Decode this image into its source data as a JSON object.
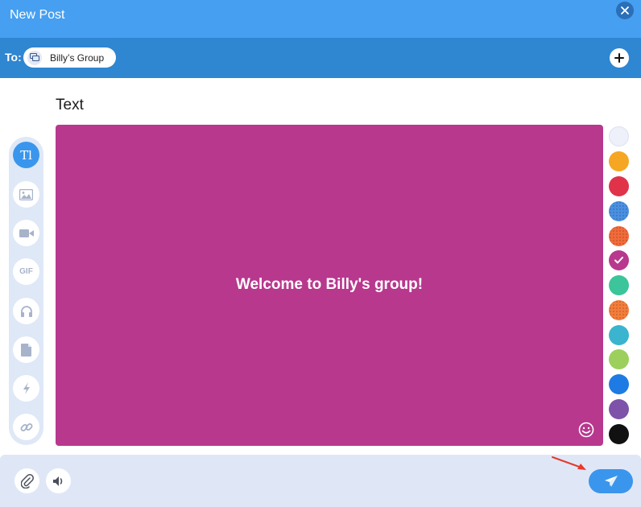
{
  "header": {
    "title": "New Post"
  },
  "to_bar": {
    "label": "To:",
    "recipient": "Billy’s Group"
  },
  "section": {
    "title": "Text"
  },
  "tools": [
    {
      "name": "text",
      "icon": "text-icon",
      "active": true
    },
    {
      "name": "image",
      "icon": "image-icon",
      "active": false
    },
    {
      "name": "video",
      "icon": "video-icon",
      "active": false
    },
    {
      "name": "gif",
      "icon": "gif-icon",
      "active": false,
      "label": "GIF"
    },
    {
      "name": "audio",
      "icon": "headphones-icon",
      "active": false
    },
    {
      "name": "document",
      "icon": "document-icon",
      "active": false
    },
    {
      "name": "flash",
      "icon": "lightning-icon",
      "active": false
    },
    {
      "name": "link",
      "icon": "link-icon",
      "active": false
    }
  ],
  "text_icon_label": "Tl",
  "canvas": {
    "text": "Welcome to Billy's group!",
    "background": "#b8388e"
  },
  "colors": [
    {
      "hex": "#eef1fa",
      "selected": false
    },
    {
      "hex": "#f5a623",
      "selected": false
    },
    {
      "hex": "#e0334a",
      "selected": false
    },
    {
      "hex": "#4a90e2",
      "selected": false,
      "textured": true
    },
    {
      "hex": "#f26b3a",
      "selected": false,
      "textured": true
    },
    {
      "hex": "#b8388e",
      "selected": true
    },
    {
      "hex": "#3cc49b",
      "selected": false
    },
    {
      "hex": "#f47d3b",
      "selected": false,
      "textured": true
    },
    {
      "hex": "#3ab4cf",
      "selected": false
    },
    {
      "hex": "#9ccf5c",
      "selected": false
    },
    {
      "hex": "#1e7be3",
      "selected": false
    },
    {
      "hex": "#7e52a8",
      "selected": false
    },
    {
      "hex": "#111111",
      "selected": false
    }
  ],
  "accent": "#3a96ec"
}
